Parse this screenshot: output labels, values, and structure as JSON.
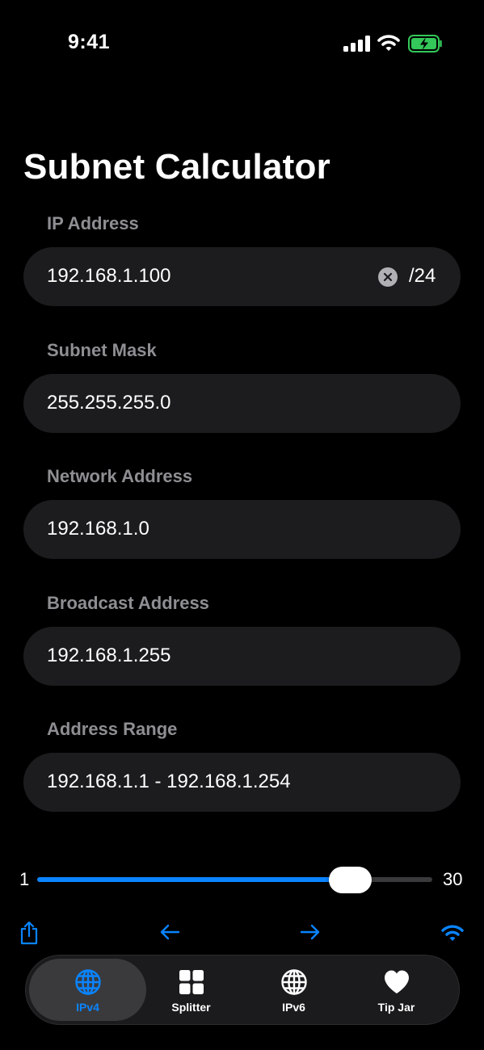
{
  "status_bar": {
    "time": "9:41"
  },
  "page": {
    "title": "Subnet Calculator"
  },
  "fields": {
    "ip": {
      "label": "IP Address",
      "value": "192.168.1.100",
      "cidr": "/24"
    },
    "mask": {
      "label": "Subnet Mask",
      "value": "255.255.255.0"
    },
    "network": {
      "label": "Network Address",
      "value": "192.168.1.0"
    },
    "broadcast": {
      "label": "Broadcast Address",
      "value": "192.168.1.255"
    },
    "range": {
      "label": "Address Range",
      "value": "192.168.1.1 - 192.168.1.254"
    }
  },
  "slider": {
    "min": "1",
    "max": "30",
    "value": 24
  },
  "toolbar": {
    "icons": [
      "share-icon",
      "arrow-left-icon",
      "arrow-right-icon",
      "wifi-icon"
    ]
  },
  "tabs": [
    {
      "label": "IPv4",
      "icon": "globe-icon",
      "active": true
    },
    {
      "label": "Splitter",
      "icon": "grid-icon",
      "active": false
    },
    {
      "label": "IPv6",
      "icon": "globe-icon",
      "active": false
    },
    {
      "label": "Tip Jar",
      "icon": "heart-icon",
      "active": false
    }
  ],
  "colors": {
    "accent": "#0a84ff",
    "background": "#000000",
    "field": "#1c1c1e",
    "label": "#8e8e93",
    "battery": "#34c759"
  }
}
